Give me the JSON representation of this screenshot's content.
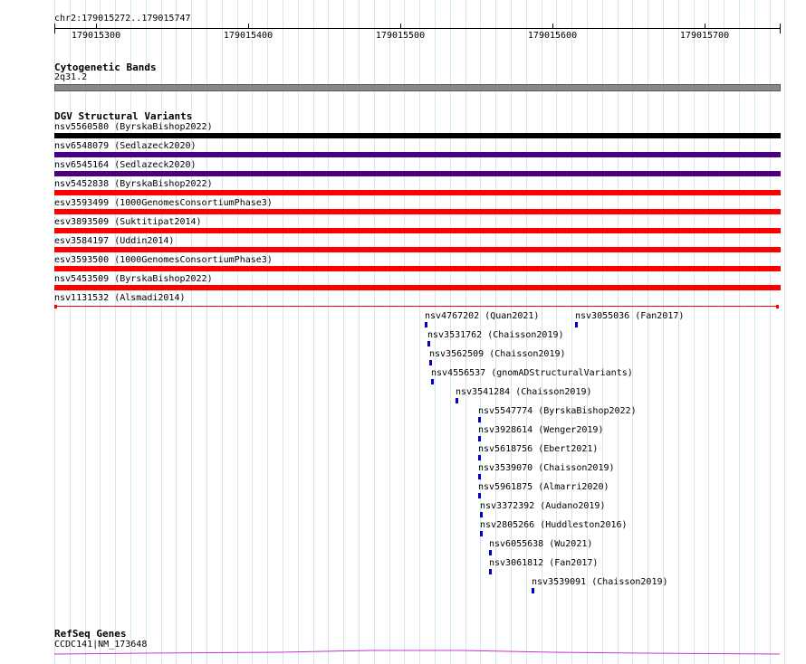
{
  "location": "chr2:179015272..179015747",
  "ruler": {
    "labels": [
      "179015300",
      "179015400",
      "179015500",
      "179015600",
      "179015700"
    ]
  },
  "cytoband": {
    "title": "Cytogenetic Bands",
    "band": "2q31.2",
    "color": "#888888"
  },
  "dgv": {
    "title": "DGV Structural Variants",
    "variants": [
      {
        "label": "nsv5560580 (ByrskaBishop2022)",
        "color": "#000000"
      },
      {
        "label": "nsv6548079 (Sedlazeck2020)",
        "color": "#4b0082"
      },
      {
        "label": "nsv6545164 (Sedlazeck2020)",
        "color": "#4b0082"
      },
      {
        "label": "nsv5452838 (ByrskaBishop2022)",
        "color": "#ff0000"
      },
      {
        "label": "esv3593499 (1000GenomesConsortiumPhase3)",
        "color": "#ff0000"
      },
      {
        "label": "esv3893509 (Suktitipat2014)",
        "color": "#ff0000"
      },
      {
        "label": "esv3584197 (Uddin2014)",
        "color": "#ff0000"
      },
      {
        "label": "esv3593500 (1000GenomesConsortiumPhase3)",
        "color": "#ff0000"
      },
      {
        "label": "nsv5453509 (ByrskaBishop2022)",
        "color": "#ff0000"
      },
      {
        "label": "nsv1131532 (Alsmadi2014)",
        "color": "#ff0000"
      }
    ],
    "small_variants": [
      {
        "label": "nsv4767202 (Quan2021)"
      },
      {
        "label": "nsv3055036 (Fan2017)"
      },
      {
        "label": "nsv3531762 (Chaisson2019)"
      },
      {
        "label": "nsv3562509 (Chaisson2019)"
      },
      {
        "label": "nsv4556537 (gnomADStructuralVariants)"
      },
      {
        "label": "nsv3541284 (Chaisson2019)"
      },
      {
        "label": "nsv5547774 (ByrskaBishop2022)"
      },
      {
        "label": "nsv3928614 (Wenger2019)"
      },
      {
        "label": "nsv5618756 (Ebert2021)"
      },
      {
        "label": "nsv3539070 (Chaisson2019)"
      },
      {
        "label": "nsv5961875 (Almarri2020)"
      },
      {
        "label": "nsv3372392 (Audano2019)"
      },
      {
        "label": "nsv2805266 (Huddleston2016)"
      },
      {
        "label": "nsv6055638 (Wu2021)"
      },
      {
        "label": "nsv3061812 (Fan2017)"
      },
      {
        "label": "nsv3539091 (Chaisson2019)"
      }
    ],
    "small_color": "#0000cc"
  },
  "refseq": {
    "title": "RefSeq Genes",
    "gene": "CCDC141|NM_173648",
    "color": "#cc33cc"
  }
}
